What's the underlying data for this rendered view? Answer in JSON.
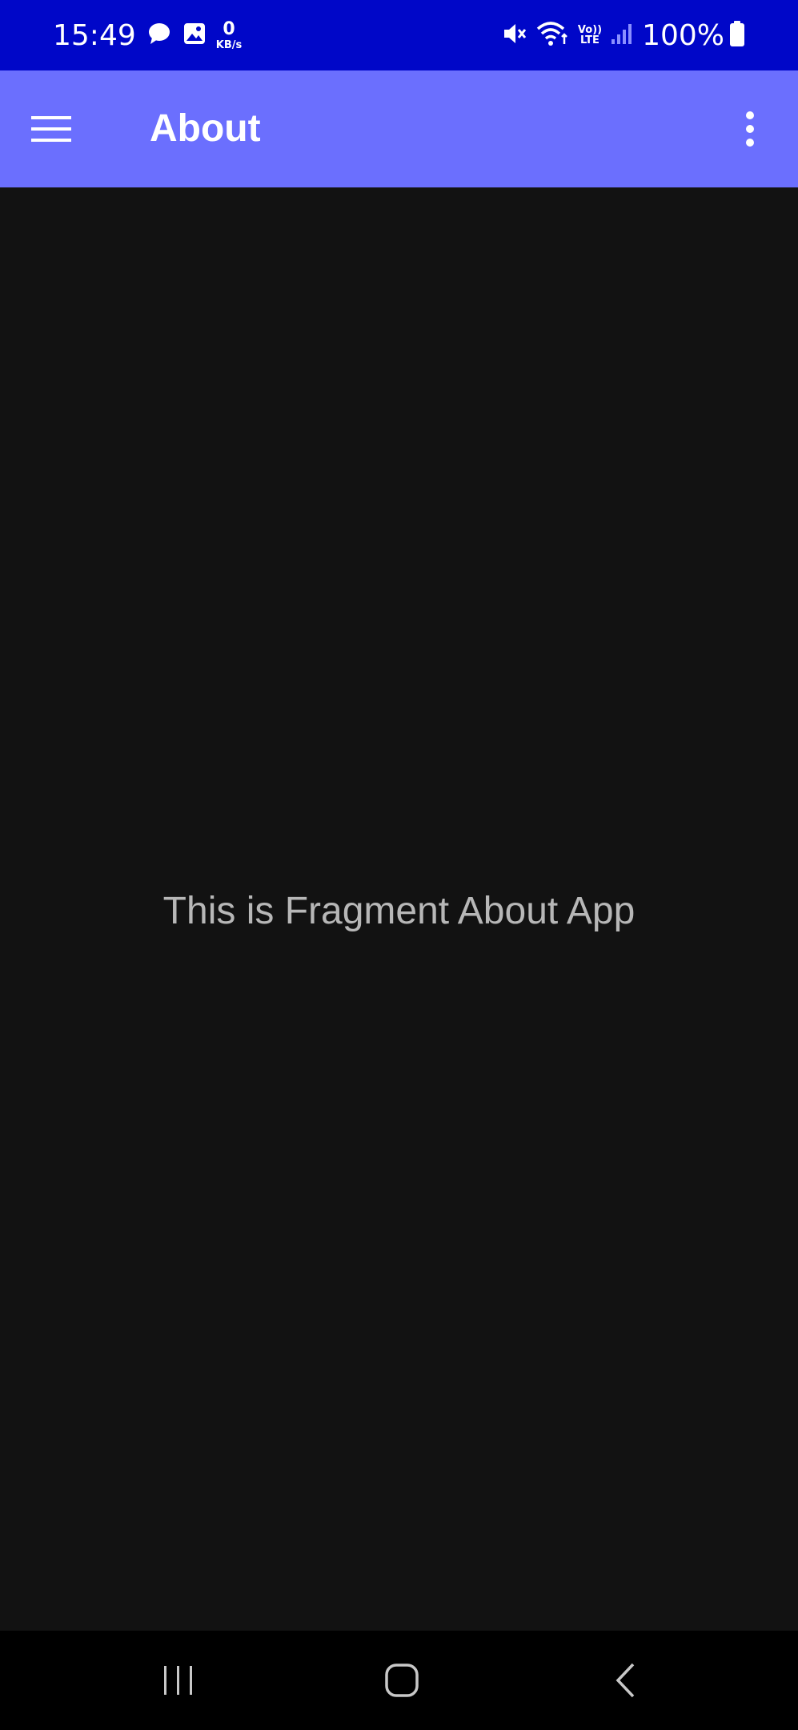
{
  "status_bar": {
    "time": "15:49",
    "net_speed_value": "0",
    "net_speed_unit": "KB/s",
    "volte_top": "Vo))",
    "volte_bottom": "LTE",
    "battery_percent": "100%",
    "icons": [
      "chat-bubble-icon",
      "gallery-icon",
      "mute-icon",
      "wifi-icon",
      "signal-icon",
      "battery-icon"
    ]
  },
  "app_bar": {
    "title": "About",
    "menu_icon": "hamburger-menu-icon",
    "overflow_icon": "more-vert-icon"
  },
  "content": {
    "message": "This is Fragment About App"
  },
  "nav_bar": {
    "icons": [
      "recent-apps-icon",
      "home-icon",
      "back-icon"
    ]
  },
  "colors": {
    "status_bar": "#0007c8",
    "app_bar": "#6b6ffe",
    "background": "#121212",
    "text": "#b7b7b7",
    "nav_bar": "#000000"
  }
}
